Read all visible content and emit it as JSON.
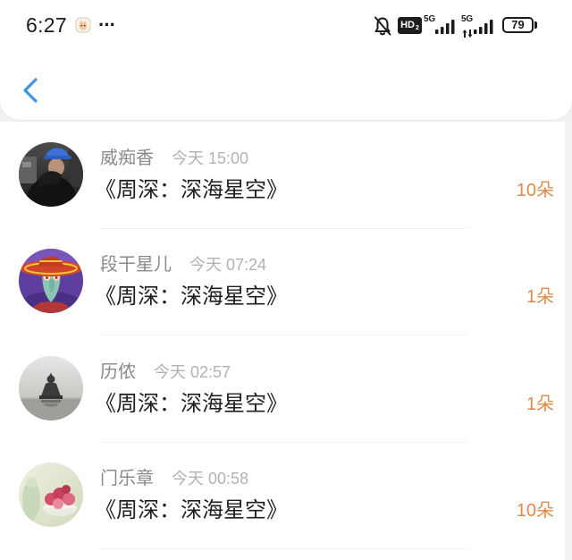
{
  "status_bar": {
    "time": "6:27",
    "more": "···",
    "hd_label": "HD",
    "hd_sim": "2",
    "sim1_network": "5G",
    "sim2_network": "5G",
    "battery": "79"
  },
  "icons": {
    "back": "chevron-left-icon",
    "notification_app": "app-notification-icon",
    "mute": "mute-bell-icon",
    "signal": "signal-bars-icon",
    "data_activity": "data-arrows-icon",
    "battery": "battery-icon"
  },
  "colors": {
    "accent": "#3a96e4",
    "name_text": "#8a8a8a",
    "time_text": "#b2b2b2",
    "title_text": "#1f1f1f",
    "count_text": "#df8a4c"
  },
  "gifts": [
    {
      "sender": "威痴香",
      "time": "今天 15:00",
      "title": "《周深：深海星空》",
      "count": "10朵"
    },
    {
      "sender": "段干星儿",
      "time": "今天 07:24",
      "title": "《周深：深海星空》",
      "count": "1朵"
    },
    {
      "sender": "历侬",
      "time": "今天 02:57",
      "title": "《周深：深海星空》",
      "count": "1朵"
    },
    {
      "sender": "门乐章",
      "time": "今天 00:58",
      "title": "《周深：深海星空》",
      "count": "10朵"
    }
  ]
}
